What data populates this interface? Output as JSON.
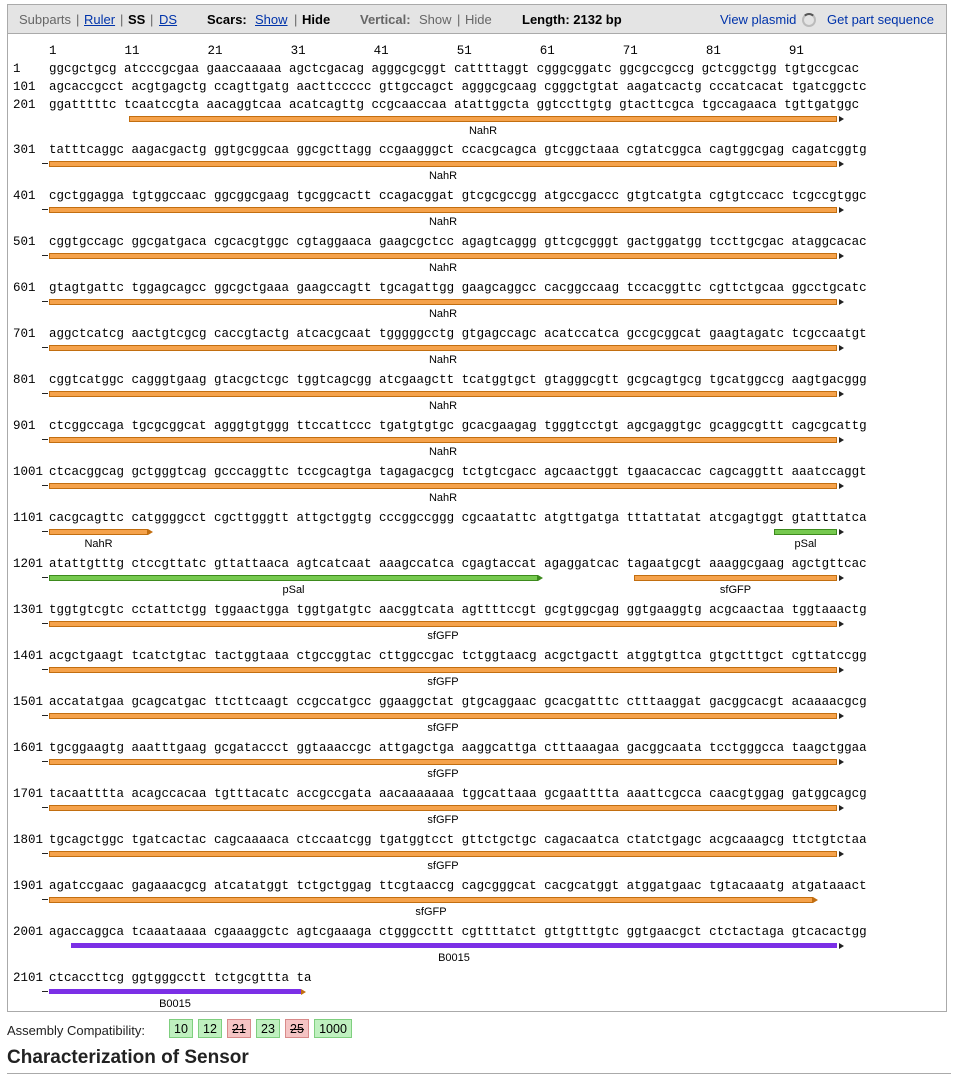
{
  "toolbar": {
    "subparts": "Subparts",
    "sep1": "|",
    "ruler": "Ruler",
    "sep2": "|",
    "ss": "SS",
    "sep3": "|",
    "ds": "DS",
    "scars_label": "Scars:",
    "scars_show": "Show",
    "sep4": "|",
    "scars_hide": "Hide",
    "vertical_label": "Vertical:",
    "vertical_show": "Show",
    "sep5": "|",
    "vertical_hide": "Hide",
    "length": "Length: 2132 bp",
    "view_plasmid": "View plasmid",
    "get_sequence": "Get part sequence"
  },
  "ruler_ticks": [
    "1",
    "11",
    "21",
    "31",
    "41",
    "51",
    "61",
    "71",
    "81",
    "91"
  ],
  "sequence_lines": [
    {
      "num": "1",
      "seq": "ggcgctgcg atcccgcgaa gaaccaaaaa agctcgacag agggcgcggt cattttaggt cgggcggatc ggcgccgccg gctcggctgg tgtgccgcac"
    },
    {
      "num": "101",
      "seq": "agcaccgcct acgtgagctg ccagttgatg aacttccccc gttgccagct agggcgcaag cgggctgtat aagatcactg cccatcacat tgatcggctc"
    },
    {
      "num": "201",
      "seq": "ggatttttc tcaatccgta aacaggtcaa acatcagttg ccgcaaccaa atattggcta ggtccttgtg gtacttcgca tgccagaaca tgttgatggc"
    },
    {
      "num": "301",
      "seq": "tatttcaggc aagacgactg ggtgcggcaa ggcgcttagg ccgaagggct ccacgcagca gtcggctaaa cgtatcggca cagtggcgag cagatcggtg"
    },
    {
      "num": "401",
      "seq": "cgctggagga tgtggccaac ggcggcgaag tgcggcactt ccagacggat gtcgcgccgg atgccgaccc gtgtcatgta cgtgtccacc tcgccgtggc"
    },
    {
      "num": "501",
      "seq": "cggtgccagc ggcgatgaca cgcacgtggc cgtaggaaca gaagcgctcc agagtcaggg gttcgcgggt gactggatgg tccttgcgac ataggcacac"
    },
    {
      "num": "601",
      "seq": "gtagtgattc tggagcagcc ggcgctgaaa gaagccagtt tgcagattgg gaagcaggcc cacggccaag tccacggttc cgttctgcaa ggcctgcatc"
    },
    {
      "num": "701",
      "seq": "aggctcatcg aactgtcgcg caccgtactg atcacgcaat tgggggcctg gtgagccagc acatccatca gccgcggcat gaagtagatc tcgccaatgt"
    },
    {
      "num": "801",
      "seq": "cggtcatggc cagggtgaag gtacgctcgc tggtcagcgg atcgaagctt tcatggtgct gtagggcgtt gcgcagtgcg tgcatggccg aagtgacggg"
    },
    {
      "num": "901",
      "seq": "ctcggccaga tgcgcggcat agggtgtggg ttccattccc tgatgtgtgc gcacgaagag tgggtcctgt agcgaggtgc gcaggcgttt cagcgcattg"
    },
    {
      "num": "1001",
      "seq": "ctcacggcag gctgggtcag gcccaggttc tccgcagtga tagagacgcg tctgtcgacc agcaactggt tgaacaccac cagcaggttt aaatccaggt"
    },
    {
      "num": "1101",
      "seq": "cacgcagttc catggggcct cgcttgggtt attgctggtg cccggccggg cgcaatattc atgttgatga tttattatat atcgagtggt gtatttatca"
    },
    {
      "num": "1201",
      "seq": "atattgtttg ctccgttatc gttattaaca agtcatcaat aaagccatca cgagtaccat agaggatcac tagaatgcgt aaaggcgaag agctgttcac"
    },
    {
      "num": "1301",
      "seq": "tggtgtcgtc cctattctgg tggaactgga tggtgatgtc aacggtcata agttttccgt gcgtggcgag ggtgaaggtg acgcaactaa tggtaaactg"
    },
    {
      "num": "1401",
      "seq": "acgctgaagt tcatctgtac tactggtaaa ctgccggtac cttggccgac tctggtaacg acgctgactt atggtgttca gtgctttgct cgttatccgg"
    },
    {
      "num": "1501",
      "seq": "accatatgaa gcagcatgac ttcttcaagt ccgccatgcc ggaaggctat gtgcaggaac gcacgatttc ctttaaggat gacggcacgt acaaaacgcg"
    },
    {
      "num": "1601",
      "seq": "tgcggaagtg aaatttgaag gcgataccct ggtaaaccgc attgagctga aaggcattga ctttaaagaa gacggcaata tcctgggcca taagctggaa"
    },
    {
      "num": "1701",
      "seq": "tacaatttta acagccacaa tgtttacatc accgccgata aacaaaaaaa tggcattaaa gcgaatttta aaattcgcca caacgtggag gatggcagcg"
    },
    {
      "num": "1801",
      "seq": "tgcagctggc tgatcactac cagcaaaaca ctccaatcgg tgatggtcct gttctgctgc cagacaatca ctatctgagc acgcaaagcg ttctgtctaa"
    },
    {
      "num": "1901",
      "seq": "agatccgaac gagaaacgcg atcatatggt tctgctggag ttcgtaaccg cagcgggcat cacgcatggt atggatgaac tgtacaaatg atgataaact"
    },
    {
      "num": "2001",
      "seq": "agaccaggca tcaaataaaa cgaaaggctc agtcgaaaga ctgggccttt cgttttatct gttgtttgtc ggtgaacgct ctctactaga gtcacactgg"
    },
    {
      "num": "2101",
      "seq": "ctcaccttcg ggtgggcctt tctgcgttta ta"
    }
  ],
  "feature_names": {
    "nahr": "NahR",
    "psal": "pSal",
    "sfgfp": "sfGFP",
    "b0015": "B0015"
  },
  "colors": {
    "nahr": "#f5a24b",
    "psal": "#76c94f",
    "sfgfp": "#f5a24b",
    "b0015": "#7b2fe6"
  },
  "compat": {
    "label": "Assembly Compatibility:",
    "badges": [
      {
        "text": "10",
        "status": "compatible"
      },
      {
        "text": "12",
        "status": "compatible"
      },
      {
        "text": "21",
        "status": "incompatible"
      },
      {
        "text": "23",
        "status": "compatible"
      },
      {
        "text": "25",
        "status": "incompatible"
      },
      {
        "text": "1000",
        "status": "compatible"
      }
    ]
  },
  "heading": "Characterization of Sensor"
}
